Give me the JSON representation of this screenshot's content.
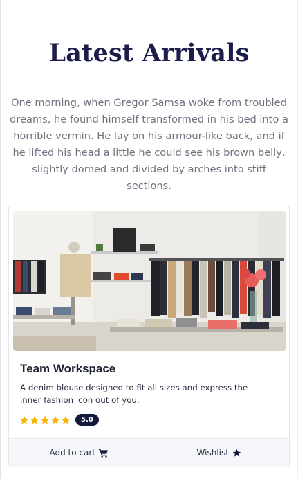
{
  "hero": {
    "title": "Latest Arrivals",
    "description": "One morning, when Gregor Samsa woke from troubled dreams, he found himself transformed in his bed into a horrible vermin. He lay on his armour-like back, and if he lifted his head a little he could see his brown belly, slightly domed and divided by arches into stiff sections."
  },
  "card": {
    "image_subject": "clothing store interior with garment racks and display tables",
    "title": "Team Workspace",
    "description": "A denim blouse designed to fit all sizes and express the inner fashion icon out of you.",
    "rating": {
      "stars": 5,
      "max": 5,
      "value_label": "5.0"
    },
    "actions": {
      "add_to_cart": "Add to cart",
      "add_to_cart_icon": "cart-icon",
      "wishlist": "Wishlist",
      "wishlist_icon": "star-icon"
    }
  },
  "colors": {
    "title": "#1c1d4a",
    "body_text": "#6f7380",
    "star": "#f5b400",
    "badge_bg": "#151a3c",
    "footer_bg": "#f4f6fa"
  }
}
